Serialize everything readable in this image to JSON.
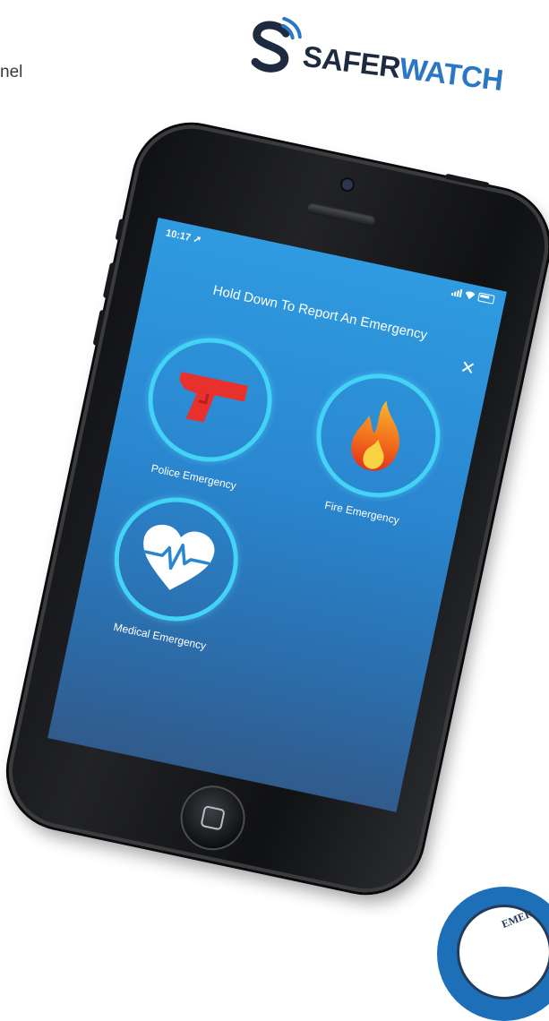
{
  "document": {
    "partial_text": "nel"
  },
  "brand": {
    "name_part1": "SAFER",
    "name_part2": "WATCH",
    "colors": {
      "dark": "#1d2a3f",
      "blue": "#2a78c5"
    }
  },
  "phone": {
    "status_bar": {
      "time": "10:17",
      "icons": [
        "location-arrow-icon",
        "signal-icon",
        "wifi-icon",
        "battery-icon"
      ]
    },
    "screen": {
      "heading": "Hold Down To Report An Emergency",
      "close_icon": "close-icon",
      "background_color": "#2a86cf",
      "ring_color": "#42d3f5",
      "emergencies": [
        {
          "label": "Police Emergency",
          "icon": "gun-icon",
          "icon_color": "#e8302c"
        },
        {
          "label": "Fire Emergency",
          "icon": "flame-icon",
          "icon_color": "#f58a1f"
        },
        {
          "label": "Medical Emergency",
          "icon": "heartbeat-icon",
          "icon_color": "#ffffff"
        }
      ]
    }
  },
  "badge": {
    "partial_text": "EMER"
  }
}
